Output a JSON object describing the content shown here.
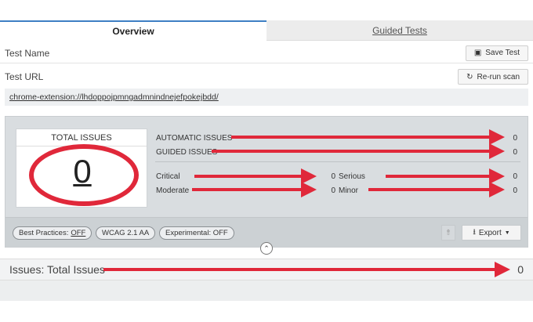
{
  "tabs": [
    {
      "label": "Overview",
      "active": true
    },
    {
      "label": "Guided Tests",
      "active": false
    }
  ],
  "test_name": {
    "label": "Test Name",
    "button": "Save Test",
    "icon": "save-icon"
  },
  "test_url": {
    "label": "Test URL",
    "button": "Re-run scan",
    "icon": "refresh-icon",
    "value": "chrome-extension://lhdoppojpmngadmnindnejefpokejbdd/"
  },
  "summary": {
    "total_title": "TOTAL ISSUES",
    "total_value": "0",
    "automatic": {
      "label": "AUTOMATIC ISSUES",
      "value": "0"
    },
    "guided": {
      "label": "GUIDED ISSUES",
      "value": "0"
    },
    "critical": {
      "label": "Critical",
      "value": "0"
    },
    "serious": {
      "label": "Serious",
      "value": "0"
    },
    "moderate": {
      "label": "Moderate",
      "value": "0"
    },
    "minor": {
      "label": "Minor",
      "value": "0"
    }
  },
  "filters": {
    "best_practices_label": "Best Practices:",
    "best_practices_value": "OFF",
    "wcag": "WCAG 2.1 AA",
    "experimental": "Experimental: OFF"
  },
  "export": {
    "label": "Export",
    "icon": "download-icon"
  },
  "issues_bar": {
    "label": "Issues: Total Issues",
    "value": "0"
  },
  "colors": {
    "accent": "#3e7fc4",
    "annotation": "#e0283a"
  }
}
